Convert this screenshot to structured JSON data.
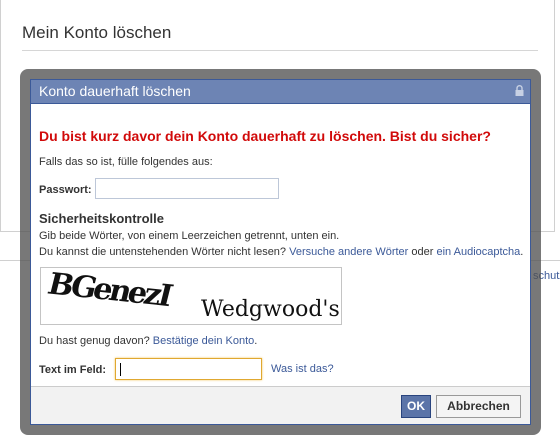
{
  "page": {
    "title": "Mein Konto löschen",
    "footer_link": "schutz"
  },
  "dialog": {
    "title": "Konto dauerhaft löschen",
    "warning": "Du bist kurz davor dein Konto dauerhaft zu löschen. Bist du sicher?",
    "intro": "Falls das so ist, fülle folgendes aus:",
    "password_label": "Passwort:",
    "password_value": "",
    "security": {
      "title": "Sicherheitskontrolle",
      "line1": "Gib beide Wörter, von einem Leerzeichen getrennt, unten ein.",
      "line2_prefix": "Du kannst die untenstehenden Wörter nicht lesen?",
      "try_other_link": "Versuche andere Wörter",
      "or_text": "oder",
      "audio_link": "ein Audiocaptcha",
      "line2_suffix": "."
    },
    "captcha": {
      "word1": "BGenezI",
      "word2": "Wedgwood's"
    },
    "enough_prefix": "Du hast genug davon?",
    "confirm_link": "Bestätige dein Konto",
    "enough_suffix": ".",
    "text_field_label": "Text im Feld:",
    "text_field_value": "",
    "what_is_link": "Was ist das?",
    "ok_label": "OK",
    "cancel_label": "Abbrechen"
  },
  "colors": {
    "header_bg": "#6d84b4",
    "warning_red": "#d10a0a",
    "link_blue": "#3b5998"
  }
}
